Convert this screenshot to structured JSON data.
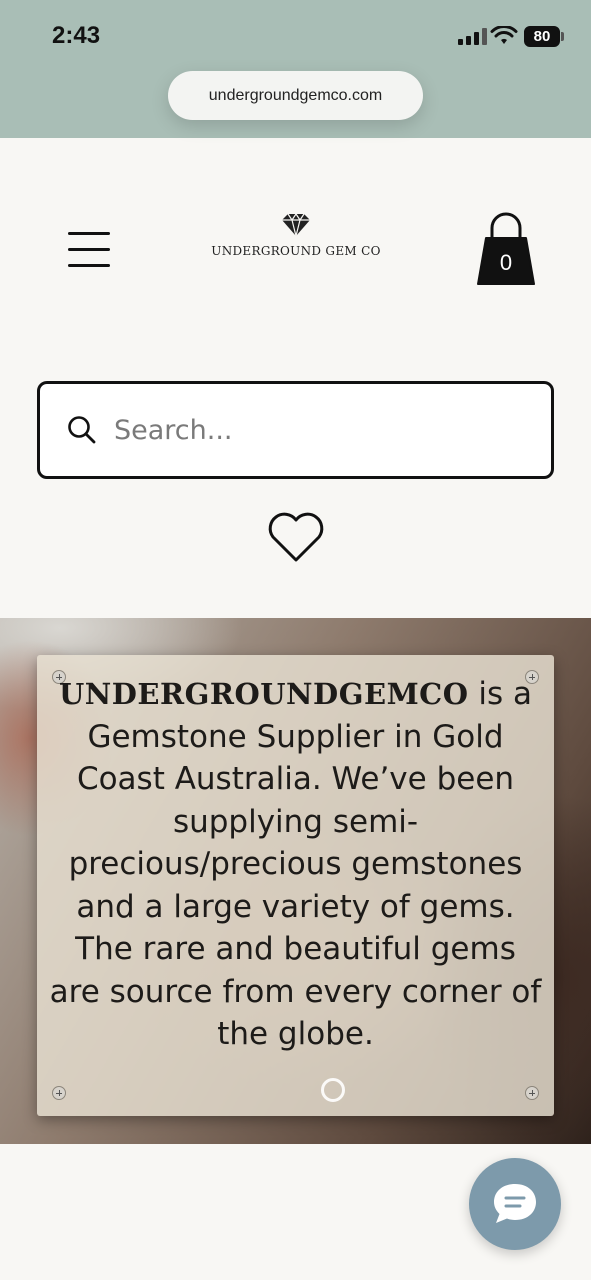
{
  "status_bar": {
    "time": "2:43",
    "battery": "80",
    "url": "undergroundgemco.com"
  },
  "header": {
    "menu_icon": "hamburger-menu-icon",
    "logo_icon": "diamond-icon",
    "logo_text": "UNDERGROUND GEM CO",
    "cart_icon": "shopping-bag-icon",
    "cart_count": "0"
  },
  "search": {
    "placeholder": "Search...",
    "icon": "search-icon"
  },
  "wishlist": {
    "icon": "heart-icon"
  },
  "hero": {
    "brand": "UNDERGROUNDGEMCO",
    "body": " is a Gemstone Supplier in Gold Coast Australia. We’ve been supplying semi-precious/precious gemstones and a large variety of gems. The rare and beautiful gems are source from every corner of the globe."
  },
  "chat": {
    "icon": "chat-bubble-icon"
  },
  "colors": {
    "status_bar_bg": "#a9beb6",
    "page_bg": "#f8f7f4",
    "chat_button": "#7d9aab"
  }
}
